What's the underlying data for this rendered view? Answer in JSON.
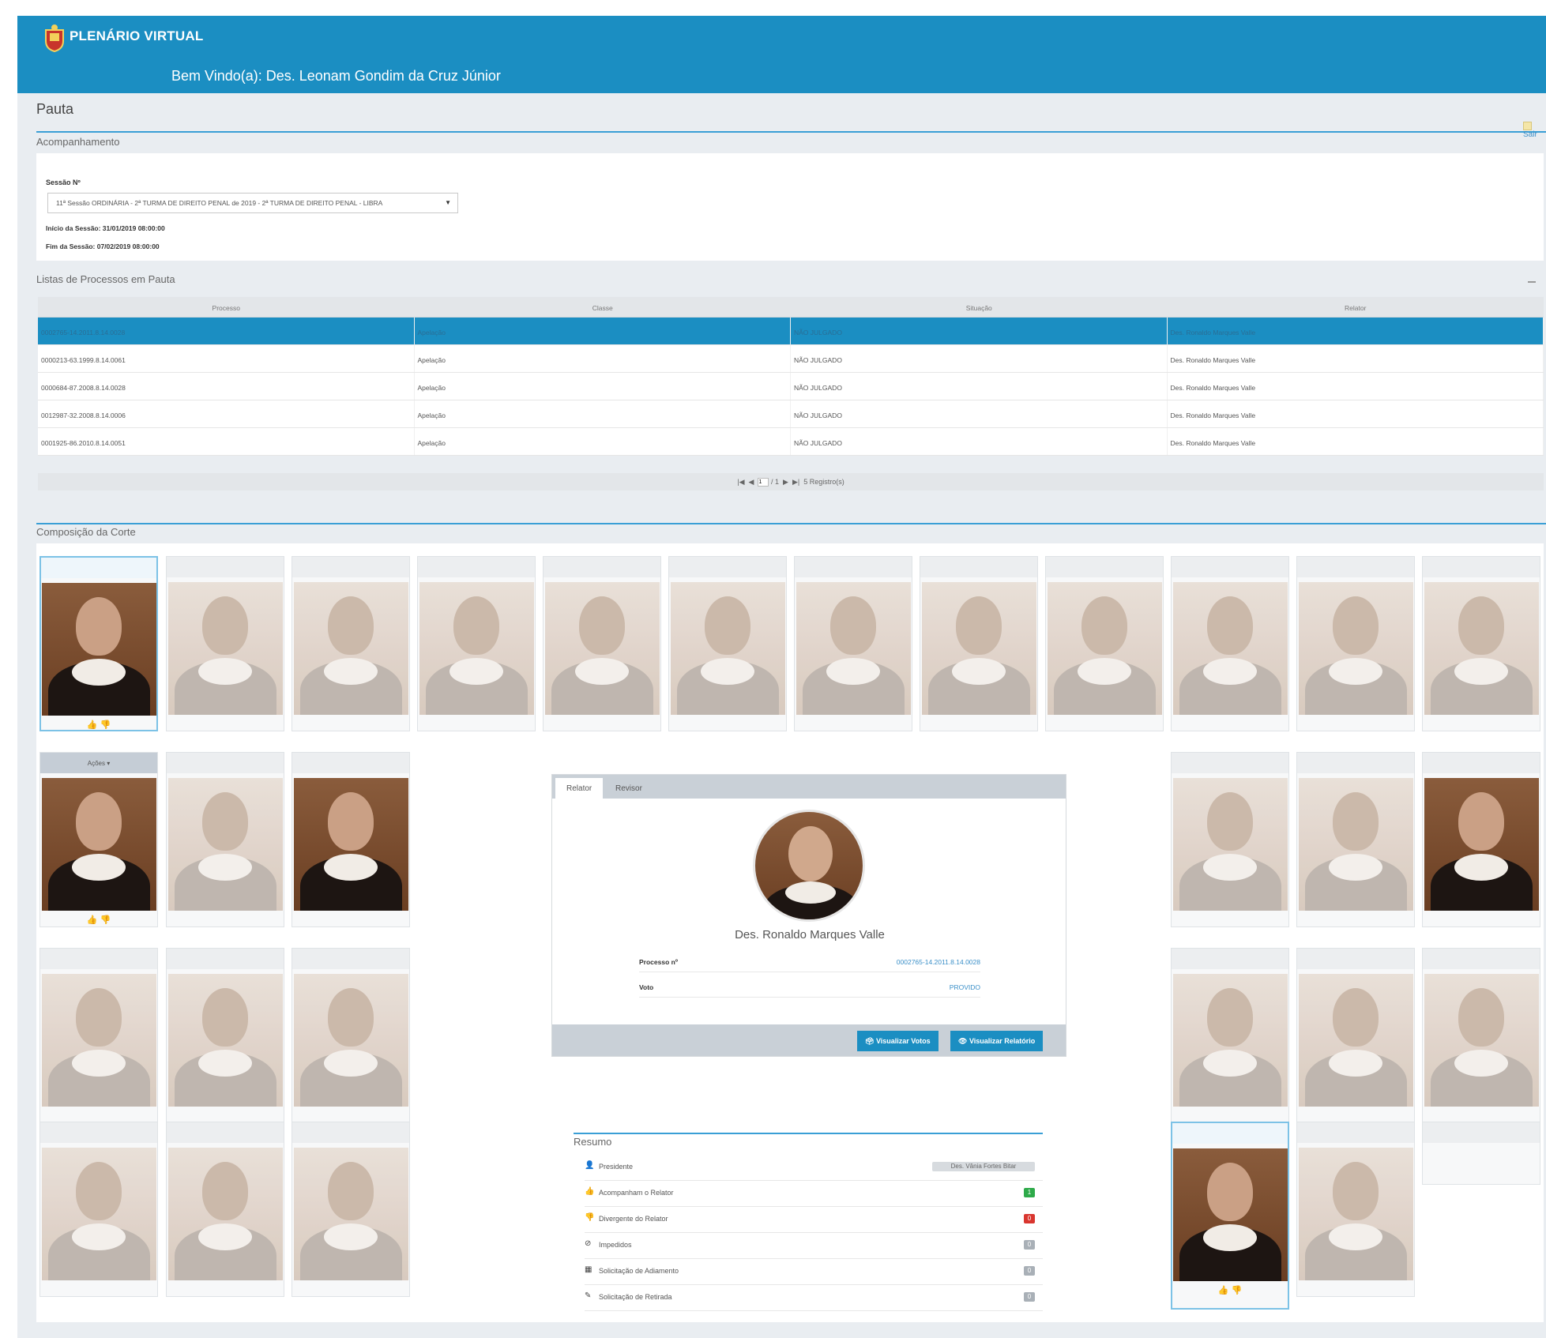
{
  "header": {
    "brand": "PLENÁRIO VIRTUAL",
    "welcome": "Bem Vindo(a): Des. Leonam Gondim da Cruz Júnior",
    "color": "#1b8ec2"
  },
  "page": {
    "title": "Pauta",
    "exit_label": "Sair"
  },
  "acompanhamento": {
    "section_title": "Acompanhamento",
    "session_label": "Sessão Nº",
    "session_value": "11ª Sessão ORDINÁRIA - 2ª TURMA DE DIREITO PENAL de 2019 - 2ª TURMA DE DIREITO PENAL - LIBRA",
    "inicio": "Início da Sessão: 31/01/2019 08:00:00",
    "fim": "Fim da Sessão: 07/02/2019 08:00:00"
  },
  "processos": {
    "section_title": "Listas de Processos em Pauta",
    "columns": [
      "Processo",
      "Classe",
      "Situação",
      "Relator"
    ],
    "rows": [
      [
        "0002765-14.2011.8.14.0028",
        "Apelação",
        "NÃO JULGADO",
        "Des. Ronaldo Marques Valle"
      ],
      [
        "0000213-63.1999.8.14.0061",
        "Apelação",
        "NÃO JULGADO",
        "Des. Ronaldo Marques Valle"
      ],
      [
        "0000684-87.2008.8.14.0028",
        "Apelação",
        "NÃO JULGADO",
        "Des. Ronaldo Marques Valle"
      ],
      [
        "0012987-32.2008.8.14.0006",
        "Apelação",
        "NÃO JULGADO",
        "Des. Ronaldo Marques Valle"
      ],
      [
        "0001925-86.2010.8.14.0051",
        "Apelação",
        "NÃO JULGADO",
        "Des. Ronaldo Marques Valle"
      ]
    ],
    "pager": {
      "first": "|◀",
      "prev": "◀",
      "page": "1",
      "of": "/ 1",
      "next": "▶",
      "last": "▶|",
      "records": "5 Registro(s)"
    }
  },
  "composicao": {
    "section_title": "Composição da Corte",
    "acoes_label": "Ações ▾",
    "like_icon": "thumbs-up-icon",
    "dislike_icon": "thumbs-down-icon"
  },
  "detalhe": {
    "tab_relator": "Relator",
    "tab_revisor": "Revisor",
    "name": "Des. Ronaldo Marques Valle",
    "processo_label": "Processo nº",
    "processo_value": "0002765-14.2011.8.14.0028",
    "voto_label": "Voto",
    "voto_value": "PROVIDO",
    "btn_votos": "Visualizar Votos",
    "btn_relatorio": "Visualizar Relatório"
  },
  "resumo": {
    "title": "Resumo",
    "rows": [
      {
        "label": "Presidente",
        "value": "Des. Vânia Fortes Bitar",
        "color": "#d7dbdf"
      },
      {
        "label": "Acompanham o Relator",
        "value": "1",
        "color": "#2eaa4a"
      },
      {
        "label": "Divergente do Relator",
        "value": "0",
        "color": "#d9362f"
      },
      {
        "label": "Impedidos",
        "value": "0",
        "color": "#a9b0b7"
      },
      {
        "label": "Solicitação de Adiamento",
        "value": "0",
        "color": "#a9b0b7"
      },
      {
        "label": "Solicitação de Retirada",
        "value": "0",
        "color": "#a9b0b7"
      }
    ]
  }
}
